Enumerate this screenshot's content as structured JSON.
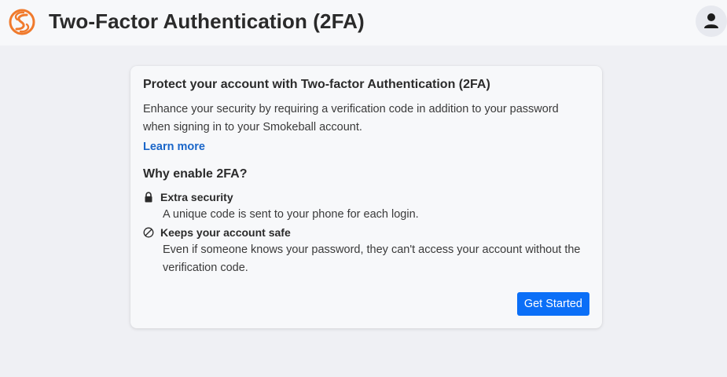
{
  "header": {
    "title": "Two-Factor Authentication (2FA)",
    "logo_icon": "smokeball-logo-icon",
    "avatar_icon": "user-icon",
    "brand_color": "#f07a2c"
  },
  "card": {
    "title": "Protect your account with Two-factor Authentication (2FA)",
    "description": "Enhance your security by requiring a verification code in addition to your password when signing in to your Smokeball account.",
    "learn_more": "Learn more",
    "why_title": "Why enable 2FA?",
    "benefits": [
      {
        "icon": "lock-icon",
        "title": "Extra security",
        "description": "A unique code is sent to your phone for each login."
      },
      {
        "icon": "prohibited-icon",
        "title": "Keeps your account safe",
        "description": "Even if someone knows your password, they can't access your account without the verification code."
      }
    ],
    "button_label": "Get Started",
    "accent_color": "#0b6ff7",
    "link_color": "#1a66c9"
  }
}
